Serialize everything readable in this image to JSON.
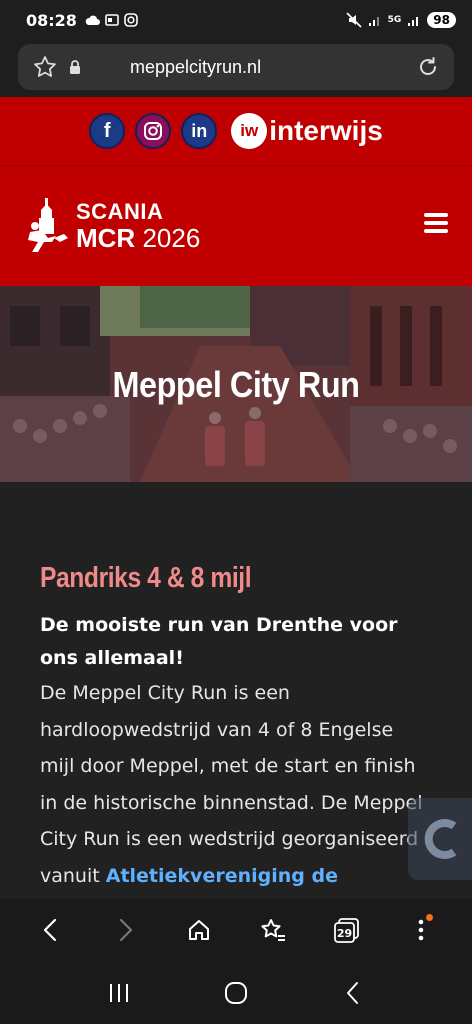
{
  "status_bar": {
    "time": "08:28",
    "battery": "98",
    "network": "5G"
  },
  "browser": {
    "url": "meppelcityrun.nl",
    "tabs_count": "29"
  },
  "social": {
    "facebook": "f",
    "instagram": "ig",
    "linkedin": "in",
    "interwijs_mark": "iw",
    "interwijs_label": "interwijs"
  },
  "header": {
    "logo_top": "SCANIA",
    "logo_bottom_a": "MCR",
    "logo_bottom_b": " 2026"
  },
  "hero": {
    "title": "Meppel City Run"
  },
  "content": {
    "subtitle": "Pandriks 4 & 8 mijl",
    "lead": "De mooiste run van Drenthe voor ons allemaal!",
    "body_before_link": "De Meppel City Run is een hardloopwedstrijd van 4 of 8 Engelse mijl door Meppel, met de start en finish in de historische binnenstad. De Meppel City Run is een wedstrijd georganiseerd vanuit ",
    "link": "Atletiekvereniging de Sprinter",
    "body_after_link": "."
  },
  "colors": {
    "brand_red": "#c00000",
    "subtitle_pink": "#f08a8a",
    "link_blue": "#5fb1ff"
  }
}
